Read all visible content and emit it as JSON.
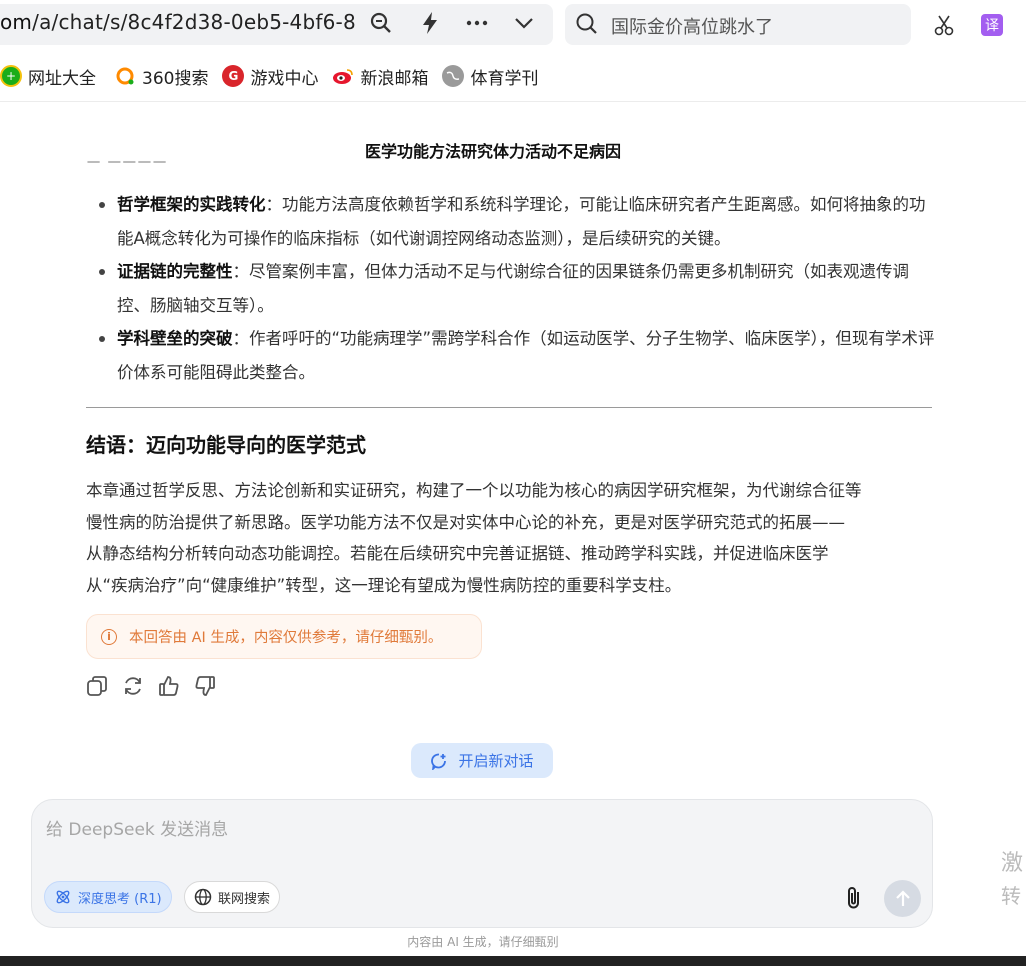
{
  "browser": {
    "url_host": "om",
    "url_path": "/a/chat/s/8c4f2d38-0eb5-4bf6-8",
    "search_text": "国际金价高位跳水了",
    "translate_label": "译",
    "bookmarks": [
      {
        "label": "网址大全",
        "icon": "plus-circle-icon",
        "color": "#1aad19"
      },
      {
        "label": "360搜索",
        "icon": "o-ring-icon",
        "color": "#ff8a00"
      },
      {
        "label": "游戏中心",
        "icon": "game-g-icon",
        "color": "#d9252b"
      },
      {
        "label": "新浪邮箱",
        "icon": "weibo-eye-icon",
        "color": "#e6162d"
      },
      {
        "label": "体育学刊",
        "icon": "globe-icon",
        "color": "#8c8c8c"
      }
    ]
  },
  "chat": {
    "title": "医学功能方法研究体力活动不足病因",
    "points": [
      {
        "bold": "哲学框架的实践转化",
        "text": "：功能方法高度依赖哲学和系统科学理论，可能让临床研究者产生距离感。如何将抽象的功能A概念转化为可操作的临床指标（如代谢调控网络动态监测），是后续研究的关键。"
      },
      {
        "bold": "证据链的完整性",
        "text": "：尽管案例丰富，但体力活动不足与代谢综合征的因果链条仍需更多机制研究（如表观遗传调控、肠脑轴交互等）。"
      },
      {
        "bold": "学科壁垒的突破",
        "text": "：作者呼吁的“功能病理学”需跨学科合作（如运动医学、分子生物学、临床医学），但现有学术评价体系可能阻碍此类整合。"
      }
    ],
    "conclusion_heading": "结语：迈向功能导向的医学范式",
    "conclusion_lines": [
      "本章通过哲学反思、方法论创新和实证研究，构建了一个以功能为核心的病因学研究框架，为代谢综合征等",
      "慢性病的防治提供了新思路。医学功能方法不仅是对实体中心论的补充，更是对医学研究范式的拓展——",
      "从静态结构分析转向动态功能调控。若能在后续研究中完善证据链、推动跨学科实践，并促进临床医学",
      "从“疾病治疗”向“健康维护”转型，这一理论有望成为慢性病防控的重要科学支柱。"
    ],
    "ai_notice": "本回答由 AI 生成，内容仅供参考，请仔细甄别。",
    "new_chat_label": "开启新对话",
    "input_placeholder": "给 DeepSeek 发送消息",
    "deep_think_label": "深度思考 (R1)",
    "web_search_label": "联网搜索",
    "footer_note": "内容由 AI 生成，请仔细甄别",
    "side_chars": [
      "激",
      "转"
    ]
  },
  "colors": {
    "accent": "#3b74e6",
    "notice": "#e07a3a"
  }
}
